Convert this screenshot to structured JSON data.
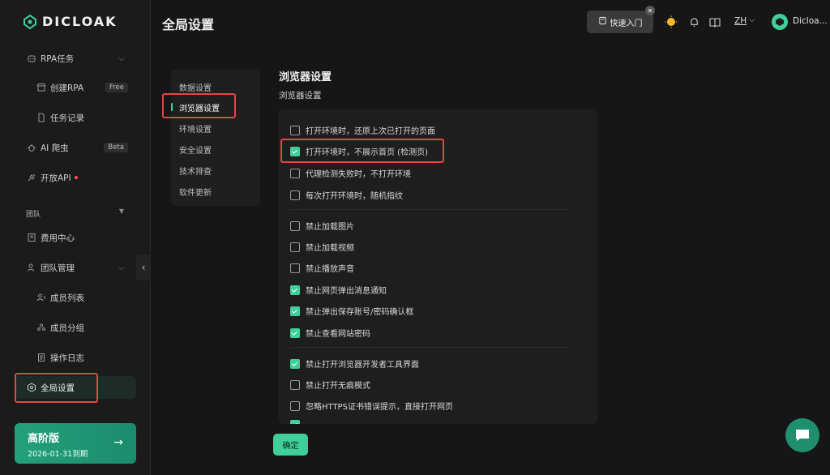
{
  "app": {
    "logo_text": "DICLOAK"
  },
  "sidebar": {
    "items": [
      {
        "label": "RPA任务"
      },
      {
        "label": "创建RPA",
        "badge": "Free"
      },
      {
        "label": "任务记录"
      },
      {
        "label": "AI 爬虫",
        "badge": "Beta"
      },
      {
        "label": "开放API"
      }
    ],
    "team_section": "团队",
    "team_items": [
      {
        "label": "费用中心"
      },
      {
        "label": "团队管理"
      },
      {
        "label": "成员列表"
      },
      {
        "label": "成员分组"
      },
      {
        "label": "操作日志"
      },
      {
        "label": "全局设置"
      }
    ],
    "plan": {
      "title": "高阶版",
      "date": "2026-01-31到期"
    }
  },
  "header": {
    "title": "全局设置",
    "quick_start": "快速入门",
    "lang": "ZH",
    "user_name": "Dicloa..."
  },
  "settings_menu": {
    "items": [
      "数据设置",
      "浏览器设置",
      "环境设置",
      "安全设置",
      "技术排查",
      "软件更新"
    ],
    "active_index": 1
  },
  "main": {
    "title": "浏览器设置",
    "subtitle": "浏览器设置",
    "options": [
      {
        "label": "打开环境时，还原上次已打开的页面",
        "checked": false
      },
      {
        "label": "打开环境时，不展示首页 (检测页)",
        "checked": true
      },
      {
        "label": "代理检测失败时，不打开环境",
        "checked": false
      },
      {
        "label": "每次打开环境时，随机指纹",
        "checked": false
      },
      {
        "label": "禁止加载图片",
        "checked": false
      },
      {
        "label": "禁止加载视频",
        "checked": false
      },
      {
        "label": "禁止播放声音",
        "checked": false
      },
      {
        "label": "禁止网页弹出消息通知",
        "checked": true
      },
      {
        "label": "禁止弹出保存账号/密码确认框",
        "checked": true
      },
      {
        "label": "禁止查看网站密码",
        "checked": true
      },
      {
        "label": "禁止打开浏览器开发者工具界面",
        "checked": true
      },
      {
        "label": "禁止打开无痕模式",
        "checked": false
      },
      {
        "label": "忽略HTTPS证书错误提示，直接打开网页",
        "checked": false
      }
    ],
    "confirm_label": "确定"
  },
  "colors": {
    "accent": "#3ecf9a",
    "highlight": "#e64545",
    "background": "#161616"
  }
}
